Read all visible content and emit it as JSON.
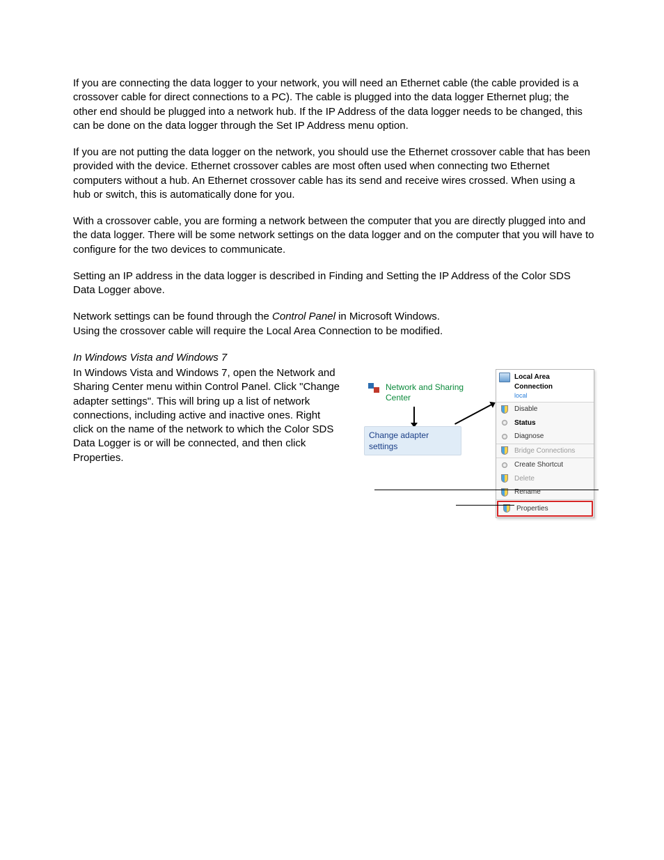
{
  "paragraphs": {
    "p1": "If you are connecting the data logger to your network, you will need an Ethernet cable (the cable provided is a crossover cable for direct connections to a PC). The cable is plugged into the data logger Ethernet plug; the other end should be plugged into a network hub.  If the IP Address of the data logger needs to be changed, this can be done on the data logger through the Set IP Address menu option.",
    "p2": "If you are not putting the data logger on the network, you should use the Ethernet crossover cable that has been provided with the device.  Ethernet crossover cables are most often used when connecting two Ethernet computers without a hub. An Ethernet crossover cable has its send and receive wires crossed.  When using a hub or switch, this is automatically done for you.",
    "p3": "With a crossover cable, you are forming a network between the computer that you are directly plugged into and the data logger.  There will be some network settings on the data logger and on the computer that you will have to configure for the two devices to communicate.",
    "p4": "Setting an IP address in the data logger is described in Finding and Setting the IP Address of the Color SDS Data Logger above.",
    "p5_pre": "Network settings can be found through the ",
    "p5_em": "Control Panel",
    "p5_post": " in Microsoft Windows.",
    "p5_line2": "Using the crossover cable will require the Local Area Connection to be modified.",
    "subheading": "In Windows Vista and Windows 7",
    "p6": "In Windows Vista and Windows 7, open the Network and Sharing Center menu within Control Panel. Click \"Change adapter settings\". This will bring up a list of network connections, including active and inactive ones. Right click on the name of the network to which the Color SDS Data Logger is or will be connected, and then click Properties."
  },
  "figure": {
    "ncs_label": "Network and Sharing Center",
    "cas_label": "Change adapter settings",
    "ctx": {
      "title": "Local Area Connection",
      "sub": "local",
      "items": [
        {
          "label": "Disable",
          "shield": true,
          "sep": false,
          "bold": false,
          "disabled": false
        },
        {
          "label": "Status",
          "shield": false,
          "sep": false,
          "bold": true,
          "disabled": false
        },
        {
          "label": "Diagnose",
          "shield": false,
          "sep": true,
          "bold": false,
          "disabled": false
        },
        {
          "label": "Bridge Connections",
          "shield": true,
          "sep": true,
          "bold": false,
          "disabled": true
        },
        {
          "label": "Create Shortcut",
          "shield": false,
          "sep": false,
          "bold": false,
          "disabled": false
        },
        {
          "label": "Delete",
          "shield": true,
          "sep": false,
          "bold": false,
          "disabled": true
        },
        {
          "label": "Rename",
          "shield": true,
          "sep": true,
          "bold": false,
          "disabled": false
        },
        {
          "label": "Properties",
          "shield": true,
          "sep": false,
          "bold": false,
          "disabled": false,
          "highlight": true
        }
      ]
    }
  }
}
